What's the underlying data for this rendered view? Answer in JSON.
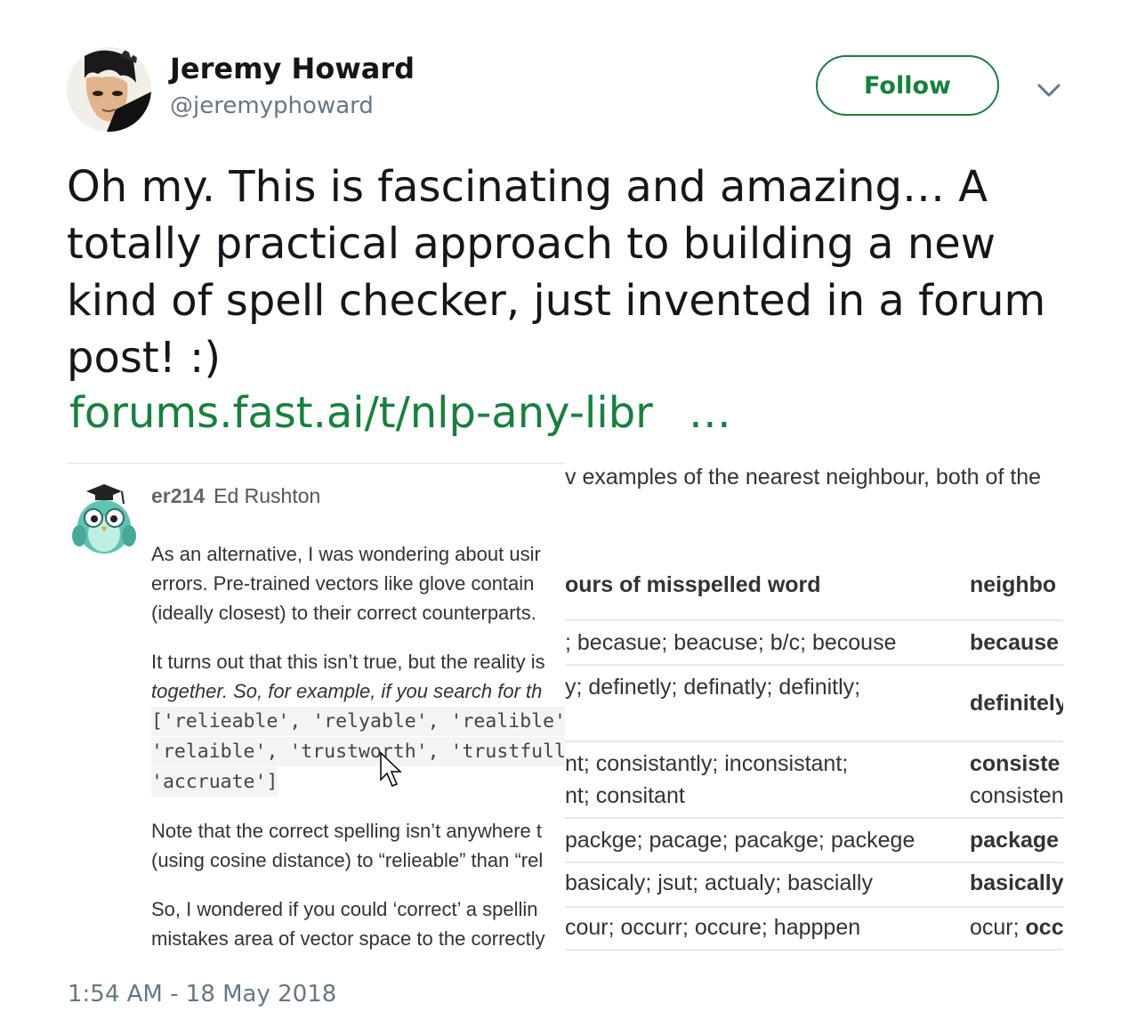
{
  "author": {
    "name": "Jeremy Howard",
    "handle": "@jeremyphoward"
  },
  "follow_label": "Follow",
  "tweet": {
    "lines": [
      "Oh my. This is fascinating and amazing… A",
      "totally practical approach to building a new",
      "kind of spell checker, just invented in a forum",
      "post! :)"
    ],
    "link_text": "forums.fast.ai/t/nlp-any-libr",
    "link_ellipsis": "…"
  },
  "media": {
    "forum_username": "er214",
    "forum_fullname": "Ed Rushton",
    "post_lines": [
      "As an alternative, I was wondering about usir",
      "errors. Pre-trained vectors like glove contain",
      "(ideally closest) to their correct counterparts.",
      "It turns out that this isn’t true, but the reality is",
      "together. So, for example, if you search for th",
      "['relieable', 'relyable', 'realible' /",
      "'relaible', 'trustworth', 'trustfull",
      "'accruate']",
      "Note that the correct spelling isn’t anywhere t",
      "(using cosine distance) to “relieable” than “rel",
      "So, I wondered if you could ‘correct’ a spellin",
      "mistakes area of vector space to the correctly"
    ],
    "overlay_top": "v examples of the nearest neighbour, both of the",
    "table": {
      "header": [
        "ours of misspelled word",
        "neighbo"
      ],
      "rows": [
        {
          "c1": [
            "; becasue; beacuse; b/c; becouse"
          ],
          "c2_bold": "because",
          "c2_extra": ""
        },
        {
          "c1": [
            "y; definetly; definatly; definitly;"
          ],
          "c2_bold": "definitely",
          "c2_extra": ""
        },
        {
          "c1": [
            "nt; consistantly; inconsistant;",
            "nt; consitant"
          ],
          "c2_bold": "consiste",
          "c2_extra": "consisten"
        },
        {
          "c1": [
            "packge; pacage; pacakge; packege"
          ],
          "c2_bold": "package",
          "c2_extra": ""
        },
        {
          "c1": [
            "basicaly; jsut; actualy; bascially"
          ],
          "c2_bold": "basically",
          "c2_extra": ""
        },
        {
          "c1": [
            "cour; occurr; occure; happpen"
          ],
          "c2_plain": "ocur; ",
          "c2_bold": "occ",
          "c2_extra": ""
        }
      ]
    }
  },
  "timestamp": "1:54 AM - 18 May 2018",
  "colors": {
    "accent": "#17803d",
    "muted": "#657786",
    "text": "#14171a"
  }
}
